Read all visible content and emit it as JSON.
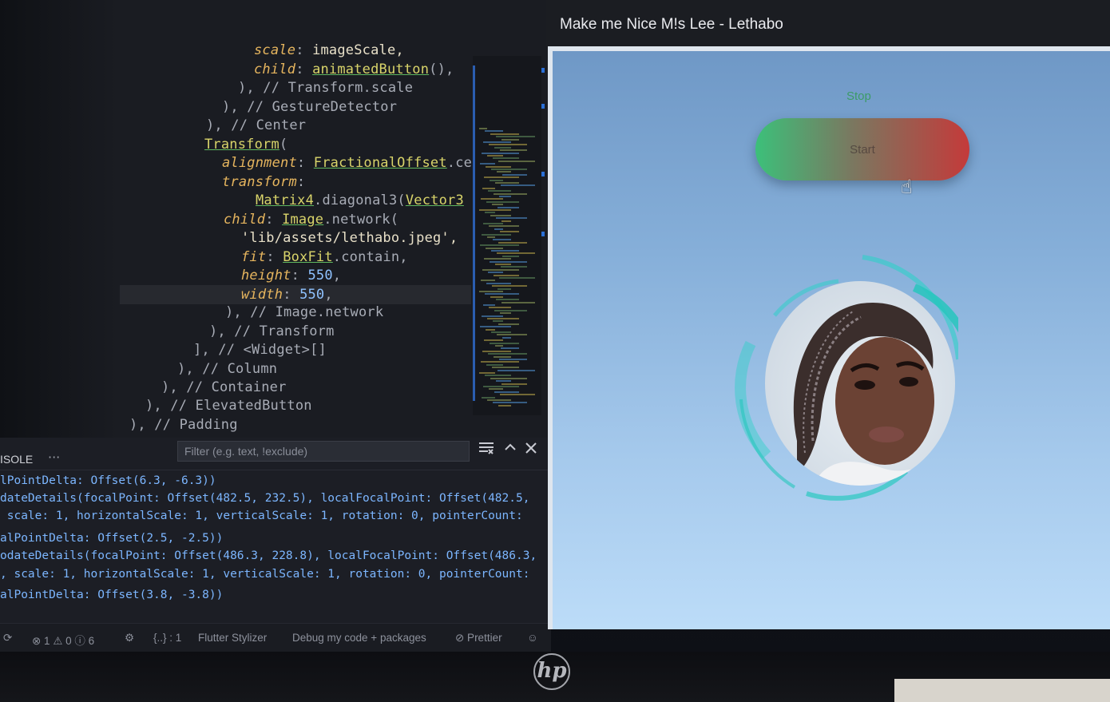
{
  "editor": {
    "header_blur": "...",
    "lines": [
      {
        "text_parts": [
          [
            "k",
            "scale"
          ],
          [
            "c",
            ": "
          ],
          [
            "s",
            "imageScale,"
          ]
        ]
      },
      {
        "text_parts": [
          [
            "k",
            "child"
          ],
          [
            "c",
            ": "
          ],
          [
            "u",
            "animatedButton"
          ],
          [
            "c",
            "(),"
          ]
        ]
      },
      {
        "text_parts": [
          [
            "c",
            "), // Transform.scale"
          ]
        ]
      },
      {
        "text_parts": [
          [
            "c",
            "), // GestureDetector"
          ]
        ]
      },
      {
        "text_parts": [
          [
            "c",
            "), // Center"
          ]
        ]
      },
      {
        "text_parts": [
          [
            "u",
            "Transform"
          ],
          [
            "c",
            "("
          ]
        ]
      },
      {
        "text_parts": [
          [
            "k",
            "alignment"
          ],
          [
            "c",
            ": "
          ],
          [
            "u",
            "FractionalOffset"
          ],
          [
            "c",
            ".ce"
          ]
        ]
      },
      {
        "text_parts": [
          [
            "k",
            "transform"
          ],
          [
            "c",
            ":"
          ]
        ]
      },
      {
        "text_parts": [
          [
            "u",
            "Matrix4"
          ],
          [
            "c",
            ".diagonal3("
          ],
          [
            "u",
            "Vector3"
          ]
        ]
      },
      {
        "text_parts": [
          [
            "k",
            "child"
          ],
          [
            "c",
            ": "
          ],
          [
            "u",
            "Image"
          ],
          [
            "c",
            ".network("
          ]
        ]
      },
      {
        "text_parts": [
          [
            "s",
            "'lib/assets/lethabo.jpeg',"
          ]
        ]
      },
      {
        "text_parts": [
          [
            "k",
            "fit"
          ],
          [
            "c",
            ": "
          ],
          [
            "u",
            "BoxFit"
          ],
          [
            "c",
            ".contain,"
          ]
        ]
      },
      {
        "text_parts": [
          [
            "k",
            "height"
          ],
          [
            "c",
            ": "
          ],
          [
            "n",
            "550"
          ],
          [
            "c",
            ","
          ]
        ]
      },
      {
        "text_parts": [
          [
            "k",
            "width"
          ],
          [
            "c",
            ": "
          ],
          [
            "n",
            "550"
          ],
          [
            "c",
            ","
          ]
        ]
      },
      {
        "text_parts": [
          [
            "c",
            "), // Image.network"
          ]
        ]
      },
      {
        "text_parts": [
          [
            "c",
            "), // Transform"
          ]
        ]
      },
      {
        "text_parts": [
          [
            "c",
            "], // <Widget>[]"
          ]
        ]
      },
      {
        "text_parts": [
          [
            "c",
            "), // Column"
          ]
        ]
      },
      {
        "text_parts": [
          [
            "c",
            "), // Container"
          ]
        ]
      },
      {
        "text_parts": [
          [
            "c",
            "), // ElevatedButton"
          ]
        ]
      },
      {
        "text_parts": [
          [
            "c",
            "), // Padding"
          ]
        ]
      }
    ]
  },
  "panel": {
    "tab_label": "ISOLE",
    "more_label": "···",
    "filter_placeholder": "Filter (e.g. text, !exclude)",
    "icons": [
      "list-filter-icon",
      "chevron-up-icon",
      "close-icon"
    ],
    "log_lines": [
      "lPointDelta: Offset(6.3, -6.3))",
      "dateDetails(focalPoint: Offset(482.5, 232.5), localFocalPoint: Offset(482.5,",
      " scale: 1, horizontalScale: 1, verticalScale: 1, rotation: 0, pointerCount:",
      "alPointDelta: Offset(2.5, -2.5))",
      "odateDetails(focalPoint: Offset(486.3, 228.8), localFocalPoint: Offset(486.3,",
      ", scale: 1, horizontalScale: 1, verticalScale: 1, rotation: 0, pointerCount:",
      "alPointDelta: Offset(3.8, -3.8))"
    ]
  },
  "statusbar": {
    "errors": "⊗ 1 ⚠ 0 ⓘ 6",
    "cursor_info": "{..} : 1",
    "stylizer": "Flutter Stylizer",
    "debug": "Debug my code + packages",
    "prettier": "⊘ Prettier"
  },
  "app": {
    "title": "Make me Nice M!s Lee - Lethabo",
    "stop_label": "Stop",
    "button_label": "Start",
    "accent_green": "#3cc07a",
    "accent_red": "#c43a3a",
    "ring_color": "#2fd0c8"
  },
  "bezel": {
    "brand": "hp"
  }
}
